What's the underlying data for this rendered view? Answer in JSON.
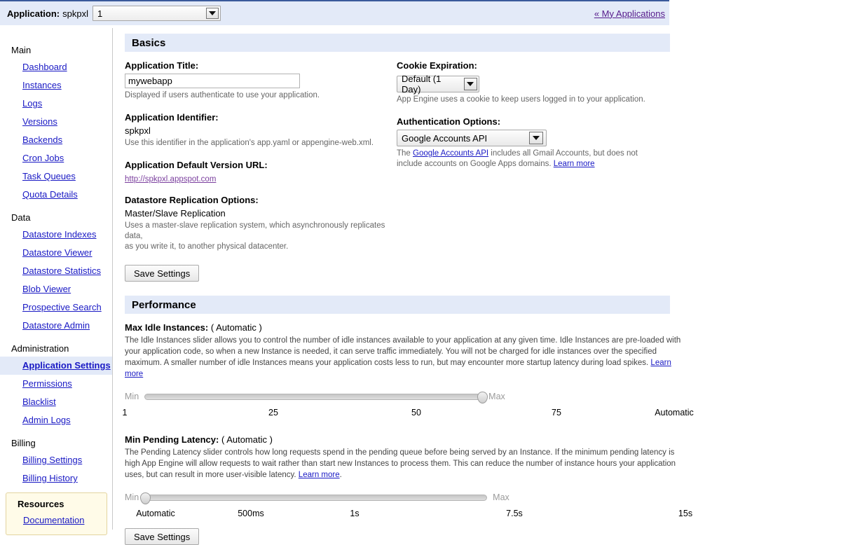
{
  "appbar": {
    "label": "Application:",
    "app_id": "spkpxl",
    "version_select_value": "1",
    "my_applications_link": "« My Applications",
    "accent_blue": "#3a5a9b",
    "bar_bg": "#e3eaf8"
  },
  "sidebar": {
    "groups": [
      {
        "title": "Main",
        "items": [
          {
            "label": "Dashboard",
            "active": false
          },
          {
            "label": "Instances",
            "active": false
          },
          {
            "label": "Logs",
            "active": false
          },
          {
            "label": "Versions",
            "active": false
          },
          {
            "label": "Backends",
            "active": false
          },
          {
            "label": "Cron Jobs",
            "active": false
          },
          {
            "label": "Task Queues",
            "active": false
          },
          {
            "label": "Quota Details",
            "active": false
          }
        ]
      },
      {
        "title": "Data",
        "items": [
          {
            "label": "Datastore Indexes",
            "active": false
          },
          {
            "label": "Datastore Viewer",
            "active": false
          },
          {
            "label": "Datastore Statistics",
            "active": false
          },
          {
            "label": "Blob Viewer",
            "active": false
          },
          {
            "label": "Prospective Search",
            "active": false
          },
          {
            "label": "Datastore Admin",
            "active": false
          }
        ]
      },
      {
        "title": "Administration",
        "items": [
          {
            "label": "Application Settings",
            "active": true
          },
          {
            "label": "Permissions",
            "active": false
          },
          {
            "label": "Blacklist",
            "active": false
          },
          {
            "label": "Admin Logs",
            "active": false
          }
        ]
      },
      {
        "title": "Billing",
        "items": [
          {
            "label": "Billing Settings",
            "active": false
          },
          {
            "label": "Billing History",
            "active": false
          }
        ]
      }
    ],
    "resources": {
      "title": "Resources",
      "items": [
        {
          "label": "Documentation"
        }
      ]
    }
  },
  "basics": {
    "header": "Basics",
    "application_title": {
      "label": "Application Title:",
      "value": "mywebapp",
      "placeholder": "",
      "hint": "Displayed if users authenticate to use your application."
    },
    "application_identifier": {
      "label": "Application Identifier:",
      "value": "spkpxl",
      "hint": "Use this identifier in the application's app.yaml or appengine-web.xml."
    },
    "default_version_url": {
      "label": "Application Default Version URL:",
      "link_text": "http://spkpxl.appspot.com"
    },
    "datastore_replication": {
      "label": "Datastore Replication Options:",
      "value": "Master/Slave Replication",
      "hint_line1": "Uses a master-slave replication system, which asynchronously replicates data,",
      "hint_line2": "as you write it, to another physical datacenter."
    },
    "cookie_expiration": {
      "label": "Cookie Expiration:",
      "selected": "Default (1 Day)",
      "hint": "App Engine uses a cookie to keep users logged in to your application."
    },
    "authentication_options": {
      "label": "Authentication Options:",
      "selected": "Google Accounts API",
      "hint_pre": "The ",
      "hint_link": "Google Accounts API",
      "hint_mid": " includes all Gmail Accounts, but does not include accounts on Google Apps domains. ",
      "hint_learn_more": "Learn more"
    },
    "save_button": "Save Settings"
  },
  "performance": {
    "header": "Performance",
    "max_idle_instances": {
      "label": "Max Idle Instances:",
      "value": "( Automatic )",
      "description": "The Idle Instances slider allows you to control the number of idle instances available to your application at any given time. Idle Instances are pre-loaded with your application code, so when a new Instance is needed, it can serve traffic immediately. You will not be charged for idle instances over the specified maximum. A smaller number of idle Instances means your application costs less to run, but may encounter more startup latency during load spikes. ",
      "learn_more": "Learn more",
      "slider": {
        "min_label": "Min",
        "max_label": "Max",
        "handle_percent": 100,
        "ticks": [
          {
            "label": "1",
            "percent": 0
          },
          {
            "label": "25",
            "percent": 26.5
          },
          {
            "label": "50",
            "percent": 52
          },
          {
            "label": "75",
            "percent": 77
          },
          {
            "label": "Automatic",
            "percent": 98
          }
        ]
      }
    },
    "min_pending_latency": {
      "label": "Min Pending Latency:",
      "value": "( Automatic )",
      "description": "The Pending Latency slider controls how long requests spend in the pending queue before being served by an Instance. If the minimum pending latency is high App Engine will allow requests to wait rather than start new Instances to process them. This can reduce the number of instance hours your application uses, but can result in more user-visible latency. ",
      "learn_more": "Learn more",
      "description_end": ".",
      "slider": {
        "min_label": "Min",
        "max_label": "Max",
        "handle_percent": 0,
        "ticks": [
          {
            "label": "Automatic",
            "percent": 5.5
          },
          {
            "label": "500ms",
            "percent": 22.5
          },
          {
            "label": "1s",
            "percent": 41
          },
          {
            "label": "7.5s",
            "percent": 69.5
          },
          {
            "label": "15s",
            "percent": 100
          }
        ]
      }
    },
    "save_button": "Save Settings"
  }
}
